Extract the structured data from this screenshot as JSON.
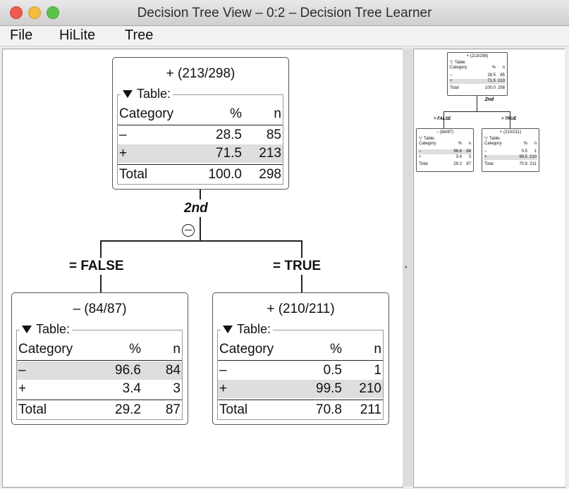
{
  "window": {
    "title": "Decision Tree View – 0:2 – Decision Tree Learner"
  },
  "menus": [
    "File",
    "HiLite",
    "Tree"
  ],
  "table_label": "Table:",
  "headers": {
    "category": "Category",
    "pct": "%",
    "n": "n"
  },
  "total_label": "Total",
  "root": {
    "title": "+ (213/298)",
    "rows": [
      {
        "cat": "–",
        "pct": "28.5",
        "n": "85"
      },
      {
        "cat": "+",
        "pct": "71.5",
        "n": "213"
      }
    ],
    "total": {
      "pct": "100.0",
      "n": "298"
    }
  },
  "split_attribute": "2nd",
  "left": {
    "edge_label": "= FALSE",
    "title": "– (84/87)",
    "rows": [
      {
        "cat": "–",
        "pct": "96.6",
        "n": "84"
      },
      {
        "cat": "+",
        "pct": "3.4",
        "n": "3"
      }
    ],
    "total": {
      "pct": "29.2",
      "n": "87"
    }
  },
  "right": {
    "edge_label": "= TRUE",
    "title": "+ (210/211)",
    "rows": [
      {
        "cat": "–",
        "pct": "0.5",
        "n": "1"
      },
      {
        "cat": "+",
        "pct": "99.5",
        "n": "210"
      }
    ],
    "total": {
      "pct": "70.8",
      "n": "211"
    }
  },
  "colors": {
    "selected_row": "#dedede",
    "close": "#f05a4f",
    "minimize": "#f4bc3d",
    "zoom": "#5cc34a"
  }
}
